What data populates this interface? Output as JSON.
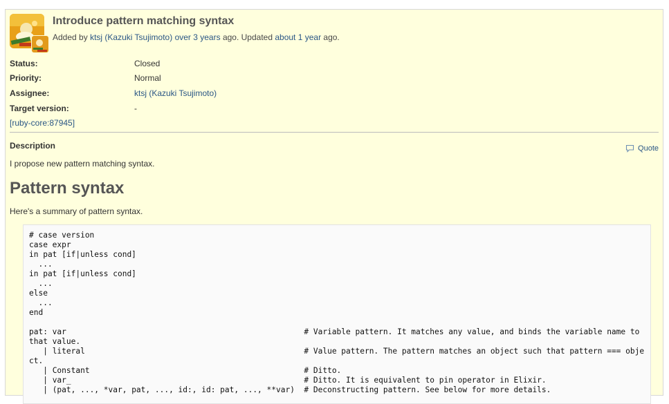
{
  "issue": {
    "title": "Introduce pattern matching syntax",
    "author": {
      "prefix": "Added by",
      "user": "ktsj (Kazuki Tsujimoto)",
      "created": "over 3 years",
      "middle": "ago. Updated",
      "updated": "about 1 year",
      "suffix": "ago."
    },
    "attributes": [
      {
        "label": "Status:",
        "value": "Closed"
      },
      {
        "label": "Priority:",
        "value": "Normal"
      },
      {
        "label": "Assignee:",
        "value": "ktsj (Kazuki Tsujimoto)"
      },
      {
        "label": "Target version:",
        "value": "-"
      }
    ],
    "reference": "[ruby-core:87945]",
    "description": {
      "label": "Description",
      "quote": "Quote",
      "intro": "I propose new pattern matching syntax.",
      "heading": "Pattern syntax",
      "summary": "Here's a summary of pattern syntax.",
      "code": "# case version\ncase expr\nin pat [if|unless cond]\n  ...\nin pat [if|unless cond]\n  ...\nelse\n  ...\nend\n\npat: var                                                   # Variable pattern. It matches any value, and binds the variable name to that value.\n   | literal                                               # Value pattern. The pattern matches an object such that pattern === object.\n   | Constant                                              # Ditto.\n   | var_                                                  # Ditto. It is equivalent to pin operator in Elixir.\n   | (pat, ..., *var, pat, ..., id:, id: pat, ..., **var)  # Deconstructing pattern. See below for more details."
    }
  },
  "colors": {
    "background": "#ffffdd",
    "link": "#2a5685",
    "border": "#d7d7d7"
  }
}
